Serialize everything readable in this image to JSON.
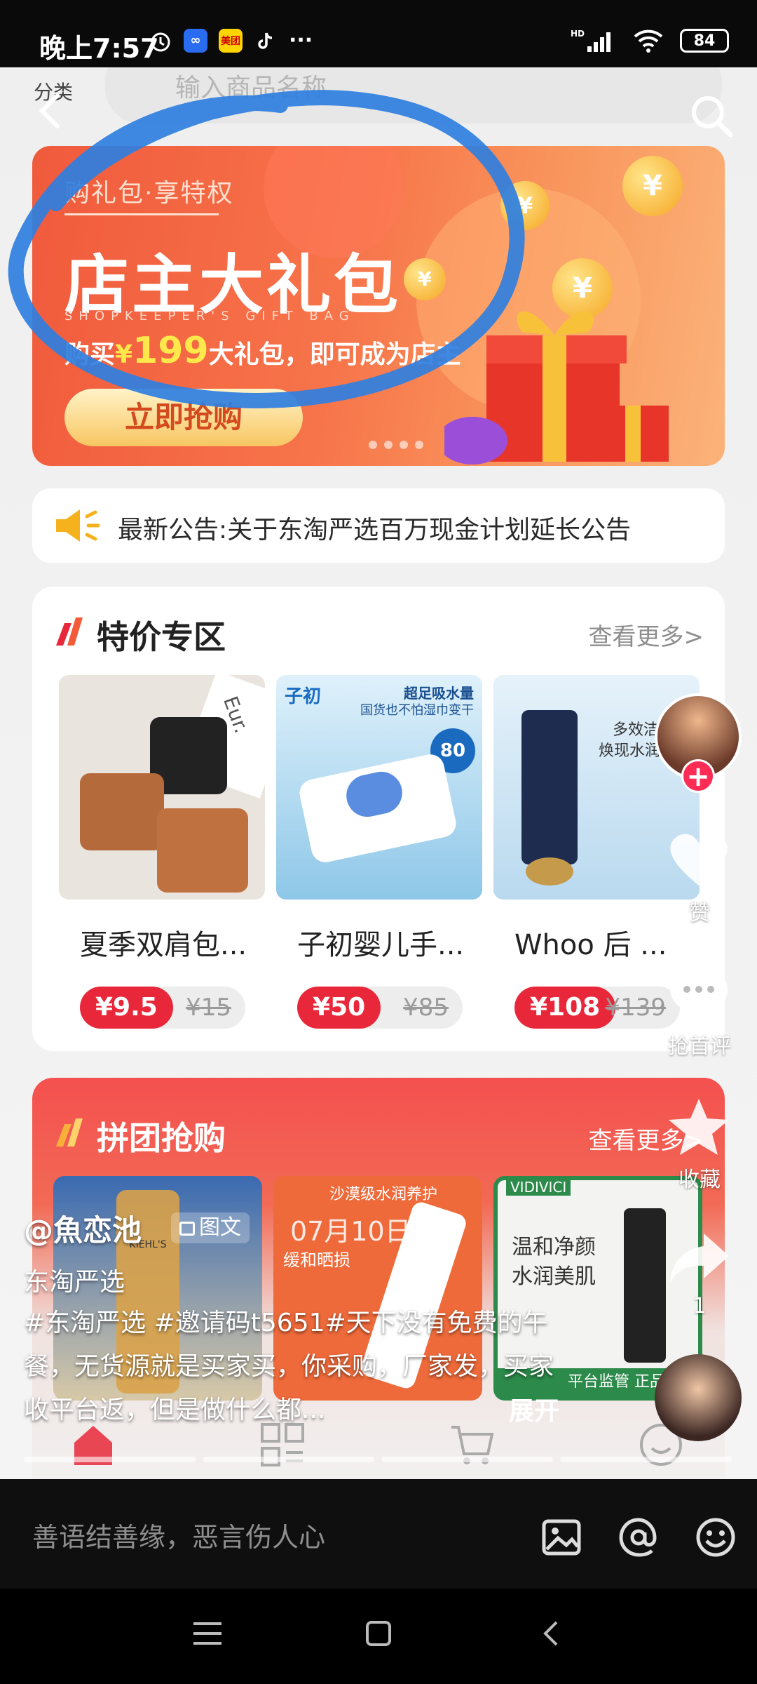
{
  "status_bar": {
    "time": "晚上7:57",
    "battery": "84",
    "signal": "HD"
  },
  "header": {
    "category_label": "分类",
    "search_placeholder": "输入商品名称"
  },
  "banner": {
    "subtitle": "购礼包·享特权",
    "title": "店主大礼包",
    "english": "SHOPKEEPER'S GIFT BAG",
    "desc_before": "购买",
    "currency": "¥",
    "price": "199",
    "desc_after": "大礼包，即可成为店主",
    "button": "立即抢购"
  },
  "notice": {
    "text": "最新公告:关于东淘严选百万现金计划延长公告"
  },
  "special_section": {
    "title": "特价专区",
    "more": "查看更多>",
    "products": [
      {
        "name": "夏季双肩包...",
        "price": "¥9.5",
        "old_price": "¥15",
        "img_text": "Eur."
      },
      {
        "name": "子初婴儿手...",
        "price": "¥50",
        "old_price": "¥85",
        "img_text": "子初",
        "img_text2": "超足吸水量",
        "img_text3": "国货也不怕湿巾变干",
        "img_badge": "80"
      },
      {
        "name": "Whoo 后 ...",
        "price": "¥108",
        "old_price": "¥139",
        "img_text": "多效洁",
        "img_text2": "焕现水润晶"
      }
    ]
  },
  "group_section": {
    "title": "拼团抢购",
    "more": "查看更多>",
    "items": [
      {
        "img_text": "KIEHL'S"
      },
      {
        "img_text": "沙漠级水润养护",
        "img_text2": "缓和晒损"
      },
      {
        "img_text": "VIDIVICI",
        "img_text2": "温和净颜",
        "img_text3": "水润美肌",
        "img_text4": "平台监管 正品"
      }
    ]
  },
  "overlay": {
    "username": "@魚恋池",
    "type_tag": "图文",
    "date": "07月10日",
    "shop": "东淘严选",
    "description": "#东淘严选 #邀请码t5651#天下没有免费的午餐，无货源就是买家买，你采购，厂家发，买家收平台返，但是做什么都...",
    "expand": "展开"
  },
  "right_rail": {
    "like_label": "赞",
    "comment_label": "抢首评",
    "fav_label": "收藏",
    "share_count": "1"
  },
  "comment_bar": {
    "placeholder": "善语结善缘，恶言伤人心"
  },
  "colors": {
    "accent": "#e8283a",
    "tiktok_red": "#fe2c55",
    "banner_orange": "#f7744a",
    "scribble_blue": "#2f7fe0"
  }
}
